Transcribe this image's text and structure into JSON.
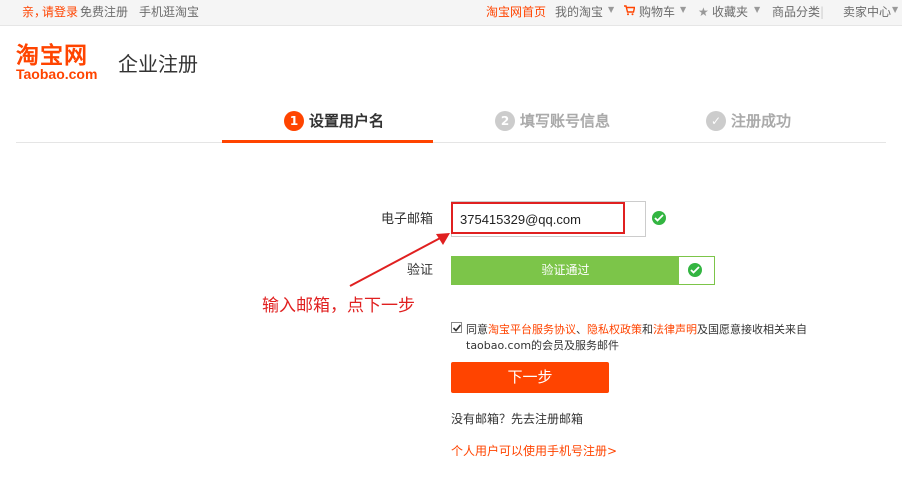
{
  "top_bar": {
    "greeting": "亲，",
    "login": "请登录",
    "register": "免费注册",
    "mobile": "手机逛淘宝",
    "home": "淘宝网首页",
    "my_taobao": "我的淘宝",
    "cart": "购物车",
    "favorites": "收藏夹",
    "categories": "商品分类",
    "seller_center": "卖家中心"
  },
  "header": {
    "logo_cn": "淘宝网",
    "logo_en": "Taobao.com",
    "title": "企业注册"
  },
  "steps": [
    {
      "num": "1",
      "label": "设置用户名",
      "state": "active"
    },
    {
      "num": "2",
      "label": "填写账号信息",
      "state": "inactive"
    },
    {
      "num": "✓",
      "label": "注册成功",
      "state": "inactive"
    }
  ],
  "form": {
    "email_label": "电子邮箱",
    "email_value": "375415329@qq.com",
    "verify_label": "验证",
    "verify_text": "验证通过",
    "agree_prefix": "同意",
    "agree_link1": "淘宝平台服务协议",
    "agree_sep1": "、",
    "agree_link2": "隐私权政策",
    "agree_and": "和",
    "agree_link3": "法律声明",
    "agree_suffix": "及国愿意接收相关来自taobao.com的会员及服务邮件",
    "next_button": "下一步",
    "no_email": "没有邮箱？先去注册邮箱",
    "mobile_register": "个人用户可以使用手机号注册>"
  },
  "annotation": {
    "text": "输入邮箱，点下一步"
  },
  "colors": {
    "brand": "#ff4400",
    "success": "#7cc549",
    "check": "#33b541",
    "annotation": "#e02020"
  },
  "icons": {
    "cart": "cart-icon",
    "star": "star-icon",
    "ok": "check-circle-icon"
  }
}
